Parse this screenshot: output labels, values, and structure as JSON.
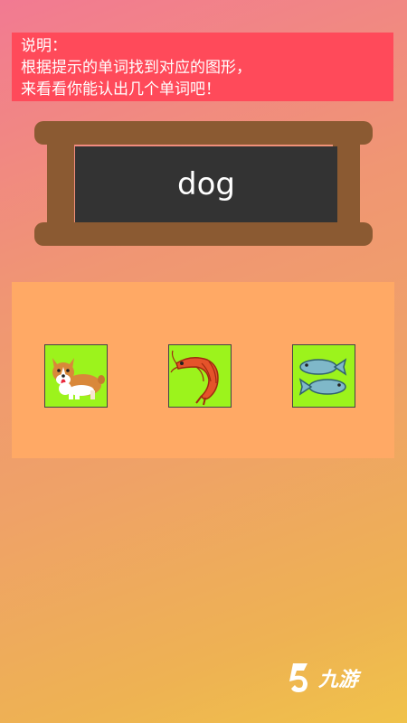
{
  "instructions": {
    "line1": "说明：",
    "line2": "根据提示的单词找到对应的图形，",
    "line3": "来看看你能认出几个单词吧！"
  },
  "prompt_word": "dog",
  "choices": [
    {
      "icon": "corgi-dog-icon"
    },
    {
      "icon": "shrimp-icon"
    },
    {
      "icon": "fish-pair-icon"
    }
  ],
  "watermark": {
    "text": "九游"
  },
  "colors": {
    "banner": "#ff4a5a",
    "board_frame": "#8b5a32",
    "board_screen": "#333333",
    "choice_panel": "#ffa965",
    "card_bg": "#9cf31c"
  }
}
